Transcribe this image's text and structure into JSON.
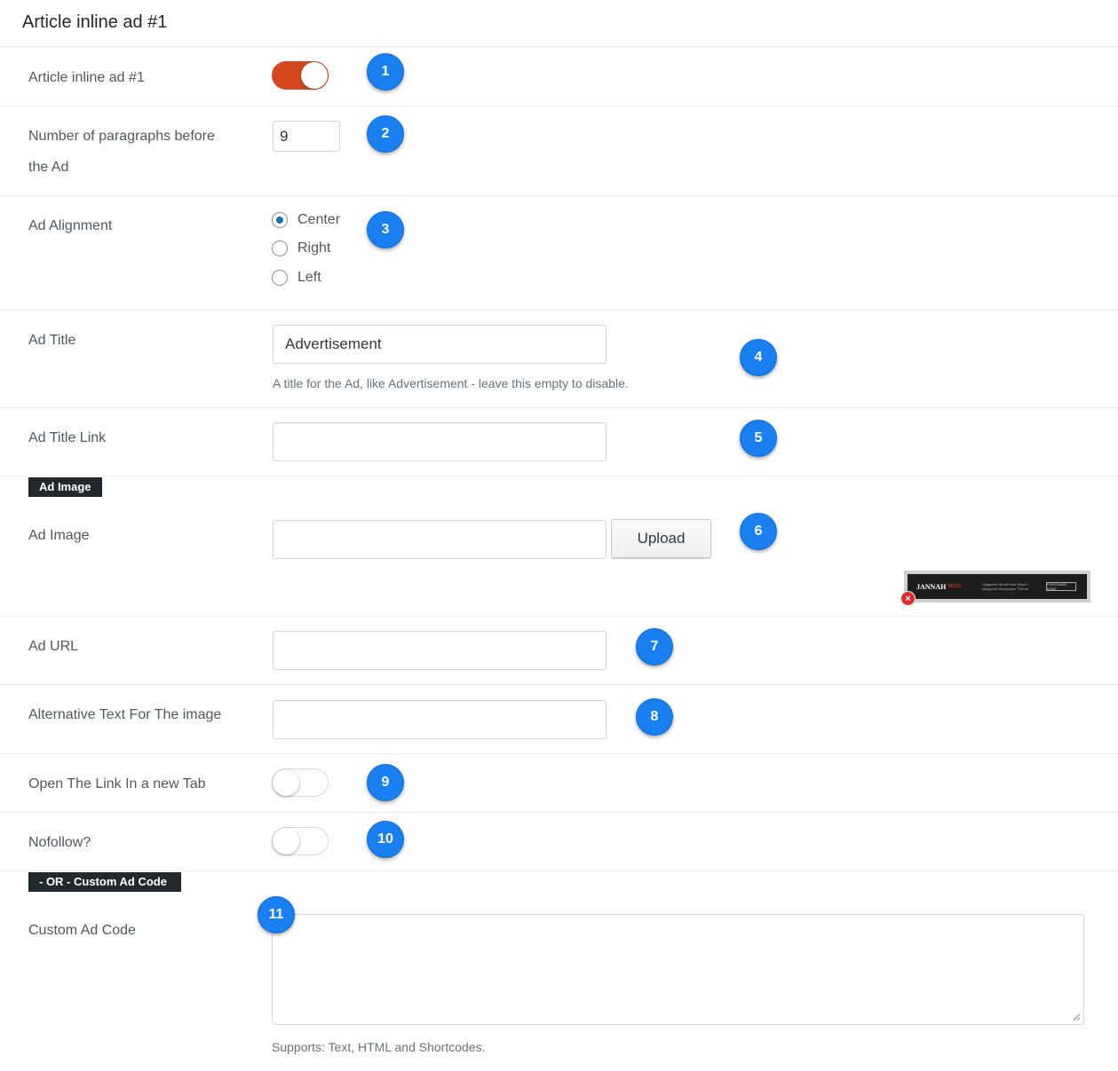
{
  "header": {
    "title": "Article inline ad #1"
  },
  "fields": {
    "enable": {
      "label": "Article inline ad #1",
      "state": "on",
      "badge": "1"
    },
    "paragraphs": {
      "label_line1": "Number of paragraphs before",
      "label_line2": "the Ad",
      "value": "9",
      "badge": "2"
    },
    "alignment": {
      "label": "Ad Alignment",
      "options": [
        "Center",
        "Right",
        "Left"
      ],
      "selected": "Center",
      "badge": "3"
    },
    "ad_title": {
      "label": "Ad Title",
      "value": "Advertisement",
      "help": "A title for the Ad, like Advertisement - leave this empty to disable.",
      "badge": "4"
    },
    "ad_title_link": {
      "label": "Ad Title Link",
      "value": "",
      "badge": "5"
    },
    "ad_image_section": {
      "tag": "Ad Image"
    },
    "ad_image": {
      "label": "Ad Image",
      "value": "",
      "upload_label": "Upload",
      "badge": "6",
      "preview": {
        "logo": "JANNAH",
        "logo_sub": "NEWS",
        "text": "Magazine WordPress News / Magazine Newspaper Theme",
        "button": "PURCHASE NOW"
      },
      "remove_icon": "×"
    },
    "ad_url": {
      "label": "Ad URL",
      "value": "",
      "badge": "7"
    },
    "alt_text": {
      "label": "Alternative Text For The image",
      "value": "",
      "badge": "8"
    },
    "new_tab": {
      "label": "Open The Link In a new Tab",
      "state": "off",
      "badge": "9"
    },
    "nofollow": {
      "label": "Nofollow?",
      "state": "off",
      "badge": "10"
    },
    "custom_section": {
      "tag": "- OR - Custom Ad Code"
    },
    "custom_code": {
      "label": "Custom Ad Code",
      "value": "",
      "help": "Supports: Text, HTML and Shortcodes.",
      "badge": "11"
    }
  },
  "colors": {
    "toggle_on": "#d5481f",
    "badge": "#1a7ff0",
    "radio_checked": "#1e6ea7",
    "tag_bg": "#23282d"
  }
}
